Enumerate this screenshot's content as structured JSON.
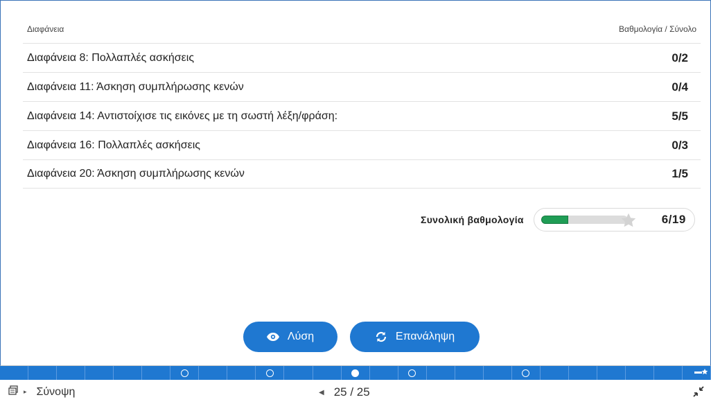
{
  "table": {
    "header_left": "Διαφάνεια",
    "header_right": "Βαθμολογία / Σύνολο",
    "rows": [
      {
        "label": "Διαφάνεια 8: Πολλαπλές ασκήσεις",
        "score": "0/2"
      },
      {
        "label": "Διαφάνεια 11: Άσκηση συμπλήρωσης κενών",
        "score": "0/4"
      },
      {
        "label": "Διαφάνεια 14: Αντιστοίχισε τις εικόνες με τη σωστή λέξη/φράση:",
        "score": "5/5"
      },
      {
        "label": "Διαφάνεια 16: Πολλαπλές ασκήσεις",
        "score": "0/3"
      },
      {
        "label": "Διαφάνεια 20: Άσκηση συμπλήρωσης κενών",
        "score": "1/5"
      }
    ]
  },
  "total": {
    "label": "Συνολική βαθμολογία",
    "value": "6/19",
    "fraction": 0.316
  },
  "buttons": {
    "solution": "Λύση",
    "retry": "Επανάληψη"
  },
  "progress": {
    "segments": 25,
    "markers": [
      {
        "index": 7,
        "state": "open"
      },
      {
        "index": 10,
        "state": "open"
      },
      {
        "index": 13,
        "state": "current"
      },
      {
        "index": 15,
        "state": "open"
      },
      {
        "index": 19,
        "state": "open"
      }
    ]
  },
  "footer": {
    "summary_label": "Σύνοψη",
    "page_indicator": "25 / 25"
  },
  "icons": {
    "eye": "eye-icon",
    "refresh": "refresh-icon",
    "star": "star-icon",
    "summary": "slides-icon",
    "prev": "triangle-left-icon",
    "shrink": "exit-fullscreen-icon"
  },
  "colors": {
    "accent": "#1f78d1",
    "progress_fill": "#1f9d55"
  }
}
